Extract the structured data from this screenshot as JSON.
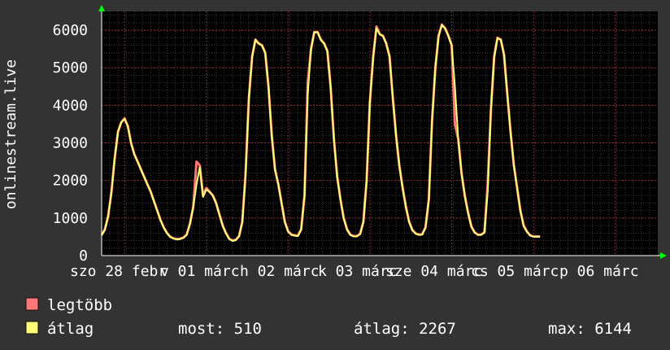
{
  "chart_data": {
    "type": "line",
    "ylabel": "onlinestream.live",
    "ylim": [
      0,
      6500
    ],
    "grid": true,
    "y_ticks": [
      "0",
      "1000",
      "2000",
      "3000",
      "4000",
      "5000",
      "6000"
    ],
    "x_tick_labels": [
      "szo 28 febr",
      "v 01 márc",
      "h 02 márc",
      "k 03 márc",
      "sze 04 márc",
      "cs 05 márc",
      "p 06 márc"
    ],
    "x": [
      0,
      0.1,
      0.2,
      0.3,
      0.4,
      0.5,
      0.6,
      0.7,
      0.8,
      0.9,
      1.0,
      1.1,
      1.2,
      1.3,
      1.4,
      1.5,
      1.6,
      1.7,
      1.8,
      1.9,
      2.0,
      2.1,
      2.2,
      2.3,
      2.4,
      2.5,
      2.6,
      2.7,
      2.8,
      2.9,
      3.0,
      3.1,
      3.2,
      3.3,
      3.4,
      3.5,
      3.6,
      3.7,
      3.8,
      3.9,
      4.0,
      4.1,
      4.2,
      4.3,
      4.4,
      4.5,
      4.6,
      4.7,
      4.8,
      4.9,
      5.0,
      5.1,
      5.2,
      5.3,
      5.4,
      5.5,
      5.6,
      5.7,
      5.8,
      5.9,
      6.0,
      6.1,
      6.2,
      6.3,
      6.4,
      6.5,
      6.6,
      6.7,
      6.8,
      6.9,
      7.0,
      7.1,
      7.2,
      7.3,
      7.4,
      7.5,
      7.6,
      7.7,
      7.8,
      7.9,
      8.0,
      8.1,
      8.2,
      8.3,
      8.4,
      8.5,
      8.6,
      8.7,
      8.8,
      8.9,
      9.0,
      9.1,
      9.2,
      9.3,
      9.4,
      9.5,
      9.6,
      9.7,
      9.8,
      9.9,
      10.0,
      10.1,
      10.2,
      10.3,
      10.4,
      10.5,
      10.6,
      10.7,
      10.8,
      10.9,
      11.0,
      11.1,
      11.2,
      11.3,
      11.4,
      11.5,
      11.6,
      11.7,
      11.8,
      11.9,
      12.0,
      12.1,
      12.2,
      12.3,
      12.4,
      12.5,
      12.6,
      12.7,
      12.8,
      12.9,
      13.0,
      13.1,
      13.2,
      13.3,
      13.4,
      13.5,
      13.6,
      13.7,
      13.8,
      13.9,
      14.0,
      14.1,
      14.2,
      14.3,
      14.4,
      14.5,
      14.6,
      14.7,
      14.8,
      14.9,
      15.0,
      15.1,
      15.2,
      15.3,
      15.4,
      15.5,
      15.6,
      15.7,
      15.8,
      15.9,
      16.0,
      16.1,
      16.2,
      16.3,
      16.4,
      16.5,
      16.6,
      16.7,
      16.8,
      16.9,
      17.0
    ],
    "series": [
      {
        "name": "legtöbb",
        "color": "#ff7777",
        "values": [
          550,
          700,
          1050,
          1700,
          2600,
          3300,
          3550,
          3650,
          3450,
          3000,
          2700,
          2500,
          2300,
          2100,
          1900,
          1700,
          1450,
          1200,
          950,
          750,
          600,
          500,
          460,
          440,
          450,
          480,
          560,
          850,
          1300,
          2500,
          2400,
          1600,
          1800,
          1700,
          1600,
          1400,
          1100,
          800,
          600,
          450,
          400,
          420,
          520,
          900,
          2200,
          4200,
          5300,
          5750,
          5650,
          5600,
          5400,
          4500,
          3200,
          2300,
          1900,
          1400,
          900,
          650,
          560,
          540,
          530,
          700,
          1600,
          4600,
          5500,
          5950,
          5950,
          5750,
          5650,
          5450,
          4500,
          3100,
          2100,
          1500,
          1000,
          700,
          560,
          520,
          520,
          580,
          900,
          2000,
          4100,
          5300,
          6100,
          5900,
          5850,
          5650,
          5300,
          4200,
          3200,
          2400,
          1800,
          1300,
          900,
          680,
          590,
          560,
          570,
          750,
          1500,
          3600,
          5000,
          5850,
          6150,
          6050,
          5850,
          5600,
          3500,
          3100,
          2200,
          1600,
          1150,
          780,
          620,
          560,
          560,
          620,
          1900,
          3900,
          5300,
          5800,
          5750,
          5350,
          4300,
          3300,
          2400,
          1800,
          1200,
          800,
          640,
          540,
          510,
          510,
          510
        ]
      },
      {
        "name": "átlag",
        "color": "#ffff77",
        "values": [
          540,
          690,
          1040,
          1690,
          2590,
          3290,
          3540,
          3640,
          3440,
          2990,
          2690,
          2490,
          2290,
          2090,
          1890,
          1690,
          1440,
          1190,
          940,
          740,
          590,
          490,
          450,
          430,
          440,
          470,
          550,
          840,
          1290,
          1900,
          2350,
          1560,
          1760,
          1690,
          1590,
          1390,
          1090,
          790,
          590,
          440,
          390,
          410,
          510,
          890,
          2100,
          4190,
          5290,
          5740,
          5640,
          5590,
          5390,
          4490,
          3190,
          2290,
          1890,
          1390,
          890,
          640,
          550,
          530,
          520,
          690,
          1590,
          4300,
          5490,
          5940,
          5940,
          5740,
          5640,
          5440,
          4490,
          3090,
          2090,
          1490,
          990,
          690,
          550,
          510,
          510,
          570,
          890,
          1990,
          4090,
          5290,
          6050,
          5890,
          5840,
          5640,
          5290,
          4190,
          3190,
          2390,
          1790,
          1290,
          890,
          670,
          580,
          550,
          560,
          740,
          1490,
          3590,
          4990,
          5840,
          6140,
          6040,
          5840,
          5590,
          4490,
          3090,
          2190,
          1590,
          1140,
          770,
          610,
          550,
          550,
          610,
          1700,
          3890,
          5290,
          5790,
          5740,
          5340,
          4290,
          3290,
          2390,
          1790,
          1190,
          790,
          630,
          530,
          500,
          500,
          500
        ]
      }
    ]
  },
  "legend": {
    "items": [
      {
        "label": "legtöbb",
        "color": "#ff7777"
      },
      {
        "label": "átlag",
        "color": "#ffff77"
      }
    ],
    "stats": {
      "most": "most: 510",
      "atlag": "átlag: 2267",
      "max": "max: 6144"
    }
  },
  "colors": {
    "background": "#333333",
    "plot_background": "#000000",
    "grid_minor": "#3a3a3a",
    "grid_major": "#8a2a2a",
    "axis": "#ffffff",
    "arrow": "#00ff00"
  }
}
